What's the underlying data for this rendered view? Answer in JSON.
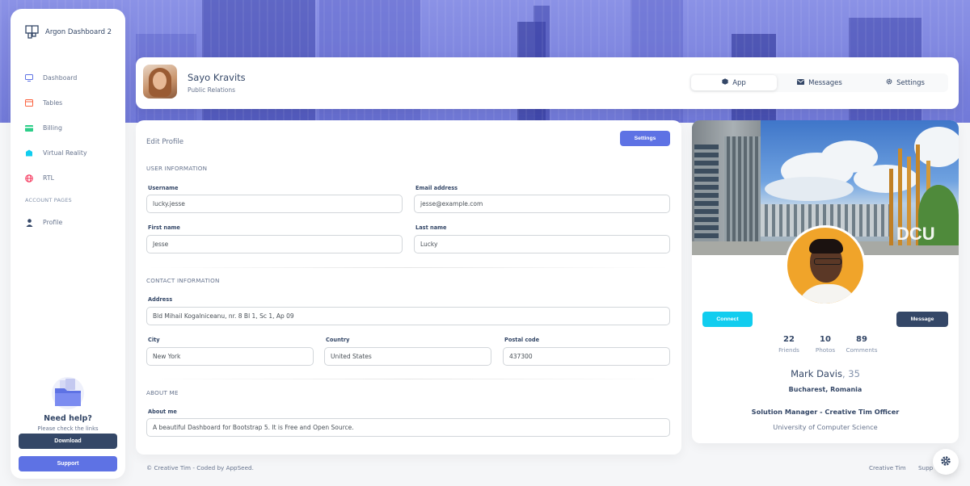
{
  "brand": {
    "name": "Argon Dashboard 2"
  },
  "sidebar": {
    "items": [
      {
        "label": "Dashboard",
        "icon": "monitor-icon",
        "color": "#5e72e4"
      },
      {
        "label": "Tables",
        "icon": "calendar-icon",
        "color": "#fb6340"
      },
      {
        "label": "Billing",
        "icon": "credit-card-icon",
        "color": "#2dce89"
      },
      {
        "label": "Virtual Reality",
        "icon": "app-icon",
        "color": "#11cdef"
      },
      {
        "label": "RTL",
        "icon": "globe-icon",
        "color": "#f5365c"
      }
    ],
    "section_label": "ACCOUNT PAGES",
    "account_items": [
      {
        "label": "Profile",
        "icon": "user-icon",
        "color": "#344767"
      }
    ],
    "help": {
      "title": "Need help?",
      "subtitle": "Please check the links",
      "download_label": "Download",
      "support_label": "Support"
    }
  },
  "header": {
    "name": "Sayo Kravits",
    "role": "Public Relations",
    "tabs": [
      {
        "label": "App",
        "icon": "cube-icon",
        "active": true
      },
      {
        "label": "Messages",
        "icon": "envelope-icon",
        "active": false
      },
      {
        "label": "Settings",
        "icon": "gear-icon",
        "active": false
      }
    ]
  },
  "edit_profile": {
    "title": "Edit Profile",
    "settings_label": "Settings",
    "user_info": {
      "heading": "USER INFORMATION",
      "username_label": "Username",
      "username_value": "lucky.jesse",
      "email_label": "Email address",
      "email_value": "jesse@example.com",
      "first_name_label": "First name",
      "first_name_value": "Jesse",
      "last_name_label": "Last name",
      "last_name_value": "Lucky"
    },
    "contact_info": {
      "heading": "CONTACT INFORMATION",
      "address_label": "Address",
      "address_value": "Bld Mihail Kogalniceanu, nr. 8 Bl 1, Sc 1, Ap 09",
      "city_label": "City",
      "city_value": "New York",
      "country_label": "Country",
      "country_value": "United States",
      "postal_label": "Postal code",
      "postal_value": "437300"
    },
    "about": {
      "heading": "ABOUT ME",
      "label": "About me",
      "value": "A beautiful Dashboard for Bootstrap 5. It is Free and Open Source."
    }
  },
  "profile_card": {
    "connect_label": "Connect",
    "message_label": "Message",
    "stats": [
      {
        "value": "22",
        "label": "Friends"
      },
      {
        "value": "10",
        "label": "Photos"
      },
      {
        "value": "89",
        "label": "Comments"
      }
    ],
    "name": "Mark Davis",
    "age": ", 35",
    "location": "Bucharest, Romania",
    "job": "Solution Manager - Creative Tim Officer",
    "university": "University of Computer Science",
    "cover_text": "DCU"
  },
  "footer": {
    "copyright": "© Creative Tim - Coded by AppSeed.",
    "links": [
      "Creative Tim",
      "Support"
    ]
  },
  "colors": {
    "primary": "#5e72e4",
    "dark": "#344767",
    "info": "#11cdef"
  }
}
